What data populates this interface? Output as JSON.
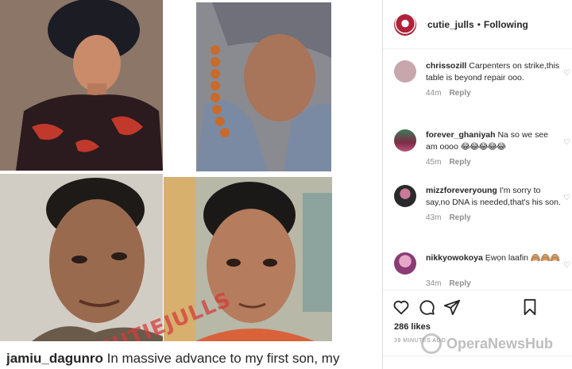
{
  "post": {
    "author": "cutie_julls",
    "follow_status": "Following",
    "separator": "•",
    "watermark": "CUTIEJULLS",
    "caption_user": "jamiu_dagunro",
    "caption_text": "In massive advance to my first son, my"
  },
  "comments": [
    {
      "username": "chrissozill",
      "text": "Carpenters on strike,this table is beyond repair ooo.",
      "time": "44m",
      "reply_label": "Reply"
    },
    {
      "username": "forever_ghaniyah",
      "text": "Na so we see am oooo",
      "emojis": "😂😂😂😂😂",
      "time": "45m",
      "reply_label": "Reply"
    },
    {
      "username": "mizzforeveryoung",
      "text": "I'm sorry to say,no DNA is needed,that's his son.",
      "time": "43m",
      "reply_label": "Reply"
    },
    {
      "username": "nikkyowokoya",
      "text": "Ẹwọn laafin",
      "emojis": "🙈🙈🙈",
      "time": "34m",
      "reply_label": "Reply"
    }
  ],
  "actions": {
    "likes": "286 likes",
    "time_ago": "39 MINUTES AGO"
  },
  "overlay": {
    "brand": "OperaNewsHub"
  },
  "icons": {
    "like": "heart-icon",
    "comment": "comment-icon",
    "share": "share-icon",
    "save": "bookmark-icon",
    "comment_like": "heart-icon"
  }
}
